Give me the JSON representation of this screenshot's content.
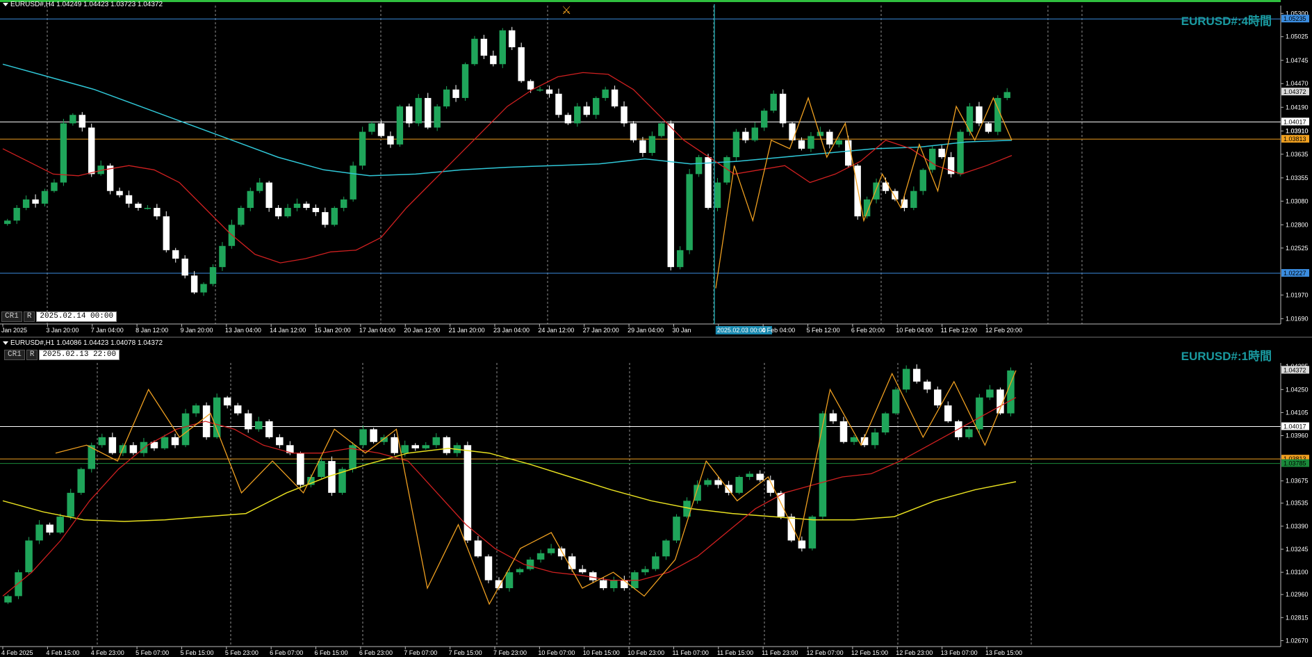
{
  "chart_data": [
    {
      "type": "candlestick",
      "symbol_line": "EURUSD#,H4  1.04249 1.04423 1.03723 1.04372",
      "title": "EURUSD#:4時間",
      "crosshair": {
        "tag1": "CR1",
        "tag2": "R",
        "datetime": "2025.02.14 00:00"
      },
      "ylim": [
        1.0166,
        1.0536
      ],
      "yticks": [
        1.053,
        1.05025,
        1.04745,
        1.0447,
        1.0419,
        1.0391,
        1.03635,
        1.03355,
        1.0308,
        1.028,
        1.02525,
        1.0197,
        1.0169
      ],
      "x_labels": [
        "Jan 2025",
        "3 Jan 20:00",
        "7 Jan 04:00",
        "8 Jan 12:00",
        "9 Jan 20:00",
        "13 Jan 04:00",
        "14 Jan 12:00",
        "15 Jan 20:00",
        "17 Jan 04:00",
        "20 Jan 12:00",
        "21 Jan 20:00",
        "23 Jan 04:00",
        "24 Jan 12:00",
        "27 Jan 20:00",
        "29 Jan 04:00",
        "30 Jan",
        "2025.02.03 00:00",
        "4 Feb 04:00",
        "5 Feb 12:00",
        "6 Feb 20:00",
        "10 Feb 04:00",
        "11 Feb 12:00",
        "12 Feb 20:00"
      ],
      "hlines": [
        {
          "value": 1.05235,
          "color": "#3b8de0",
          "label": "1.05235",
          "label_bg": "#3b8de0"
        },
        {
          "value": 1.04017,
          "color": "#ffffff",
          "label": "1.04017",
          "label_bg": "#ffffff"
        },
        {
          "value": 1.03813,
          "color": "#f0a020",
          "label": "1.03813",
          "label_bg": "#f0a020"
        },
        {
          "value": 1.02227,
          "color": "#3b8de0",
          "label": "1.02227",
          "label_bg": "#3b8de0"
        }
      ],
      "last_price": {
        "value": 1.04372,
        "label": "1.04372"
      },
      "extra_labels": [
        {
          "value": 1.0391,
          "text": "1.03910"
        }
      ],
      "highlight_label": "2025.02.03 00:00",
      "close_path": [
        1.0285,
        1.03,
        1.031,
        1.0305,
        1.032,
        1.033,
        1.04,
        1.041,
        1.0395,
        1.034,
        1.035,
        1.032,
        1.0315,
        1.0305,
        1.03,
        1.03,
        1.029,
        1.025,
        1.024,
        1.022,
        1.02,
        1.021,
        1.023,
        1.0255,
        1.028,
        1.03,
        1.032,
        1.033,
        1.03,
        1.029,
        1.03,
        1.0305,
        1.03,
        1.0295,
        1.028,
        1.03,
        1.031,
        1.035,
        1.039,
        1.04,
        1.0385,
        1.0375,
        1.042,
        1.04,
        1.043,
        1.0395,
        1.042,
        1.044,
        1.043,
        1.047,
        1.05,
        1.048,
        1.047,
        1.051,
        1.049,
        1.045,
        1.044,
        1.044,
        1.0435,
        1.041,
        1.04,
        1.042,
        1.041,
        1.043,
        1.044,
        1.042,
        1.04,
        1.038,
        1.0365,
        1.0385,
        1.04,
        1.023,
        1.025,
        1.034,
        1.036,
        1.03,
        1.033,
        1.036,
        1.039,
        1.038,
        1.0395,
        1.0415,
        1.0435,
        1.04,
        1.038,
        1.037,
        1.0385,
        1.039,
        1.0375,
        1.038,
        1.035,
        1.029,
        1.031,
        1.033,
        1.032,
        1.031,
        1.03,
        1.032,
        1.0345,
        1.037,
        1.036,
        1.034,
        1.039,
        1.042,
        1.04,
        1.039,
        1.043,
        1.0437
      ],
      "ma_red": [
        1.037,
        1.0355,
        1.034,
        1.0338,
        1.0345,
        1.035,
        1.0345,
        1.033,
        1.03,
        1.027,
        1.0245,
        1.0235,
        1.024,
        1.0248,
        1.025,
        1.0265,
        1.03,
        1.033,
        1.036,
        1.039,
        1.042,
        1.044,
        1.0455,
        1.046,
        1.0458,
        1.044,
        1.041,
        1.038,
        1.036,
        1.034,
        1.0345,
        1.035,
        1.033,
        1.034,
        1.0355,
        1.038,
        1.037,
        1.035,
        1.034,
        1.035,
        1.0362
      ],
      "ma_cyan": [
        1.047,
        1.0455,
        1.044,
        1.042,
        1.04,
        1.038,
        1.036,
        1.0345,
        1.0338,
        1.034,
        1.0345,
        1.0348,
        1.035,
        1.0352,
        1.0358,
        1.0352,
        1.0355,
        1.036,
        1.0365,
        1.037,
        1.0372,
        1.0378,
        1.038
      ],
      "zigzag": [
        1.0205,
        1.035,
        1.0285,
        1.038,
        1.037,
        1.043,
        1.036,
        1.04,
        1.0285,
        1.034,
        1.03,
        1.0375,
        1.032,
        1.042,
        1.038,
        1.043,
        1.038
      ]
    },
    {
      "type": "candlestick",
      "symbol_line": "EURUSD#,H1  1.04086 1.04423 1.04078 1.04372",
      "title": "EURUSD#:1時間",
      "crosshair": {
        "tag1": "CR1",
        "tag2": "R",
        "datetime": "2025.02.13 22:00"
      },
      "ylim": [
        1.0265,
        1.044
      ],
      "yticks": [
        1.04395,
        1.0425,
        1.04105,
        1.0396,
        1.03675,
        1.03535,
        1.0339,
        1.03245,
        1.031,
        1.0296,
        1.02815,
        1.0267
      ],
      "x_labels": [
        "4 Feb 2025",
        "4 Feb 15:00",
        "4 Feb 23:00",
        "5 Feb 07:00",
        "5 Feb 15:00",
        "5 Feb 23:00",
        "6 Feb 07:00",
        "6 Feb 15:00",
        "6 Feb 23:00",
        "7 Feb 07:00",
        "7 Feb 15:00",
        "7 Feb 23:00",
        "10 Feb 07:00",
        "10 Feb 15:00",
        "10 Feb 23:00",
        "11 Feb 07:00",
        "11 Feb 15:00",
        "11 Feb 23:00",
        "12 Feb 07:00",
        "12 Feb 15:00",
        "12 Feb 23:00",
        "13 Feb 07:00",
        "13 Feb 15:00"
      ],
      "hlines": [
        {
          "value": 1.04017,
          "color": "#ffffff",
          "label": "1.04017",
          "label_bg": "#ffffff"
        },
        {
          "value": 1.03813,
          "color": "#f0a020",
          "label": "1.03813",
          "label_bg": "#f0a020"
        },
        {
          "value": 1.03785,
          "color": "#1a8a3a",
          "label": "1.03785",
          "label_bg": "#1a8a3a"
        }
      ],
      "last_price": {
        "value": 1.04372,
        "label": "1.04372"
      },
      "close_path": [
        1.0295,
        1.031,
        1.033,
        1.034,
        1.0335,
        1.0345,
        1.036,
        1.0375,
        1.039,
        1.0395,
        1.0385,
        1.039,
        1.0385,
        1.0392,
        1.0388,
        1.0395,
        1.039,
        1.041,
        1.0415,
        1.0395,
        1.042,
        1.0415,
        1.041,
        1.04,
        1.0405,
        1.0395,
        1.039,
        1.0385,
        1.0365,
        1.037,
        1.038,
        1.036,
        1.0375,
        1.039,
        1.04,
        1.0392,
        1.0395,
        1.0385,
        1.039,
        1.0388,
        1.039,
        1.0395,
        1.0385,
        1.039,
        1.033,
        1.032,
        1.0305,
        1.03,
        1.031,
        1.0312,
        1.0318,
        1.0322,
        1.0325,
        1.032,
        1.0312,
        1.031,
        1.0305,
        1.03,
        1.0305,
        1.03,
        1.031,
        1.0312,
        1.032,
        1.033,
        1.0345,
        1.0355,
        1.0365,
        1.0368,
        1.0365,
        1.036,
        1.037,
        1.0372,
        1.0368,
        1.036,
        1.0345,
        1.033,
        1.0325,
        1.0345,
        1.041,
        1.0405,
        1.0392,
        1.0395,
        1.039,
        1.0398,
        1.041,
        1.0425,
        1.0438,
        1.043,
        1.0425,
        1.0415,
        1.0405,
        1.0395,
        1.04,
        1.042,
        1.0425,
        1.041,
        1.0437
      ],
      "ma_red": [
        1.0295,
        1.031,
        1.033,
        1.0355,
        1.0375,
        1.039,
        1.04,
        1.0405,
        1.04,
        1.039,
        1.0385,
        1.0385,
        1.0388,
        1.0385,
        1.038,
        1.036,
        1.034,
        1.0325,
        1.0315,
        1.031,
        1.0308,
        1.0305,
        1.0305,
        1.031,
        1.032,
        1.0335,
        1.035,
        1.036,
        1.0365,
        1.037,
        1.0372,
        1.038,
        1.039,
        1.04,
        1.041,
        1.042
      ],
      "ma_yellow": [
        1.0355,
        1.0348,
        1.0343,
        1.0342,
        1.0343,
        1.0345,
        1.0347,
        1.036,
        1.037,
        1.0378,
        1.0385,
        1.0388,
        1.0385,
        1.0378,
        1.037,
        1.0362,
        1.0355,
        1.035,
        1.0347,
        1.0345,
        1.0343,
        1.0343,
        1.0345,
        1.0355,
        1.0362,
        1.0367
      ],
      "zigzag": [
        1.0385,
        1.039,
        1.038,
        1.0425,
        1.0395,
        1.041,
        1.036,
        1.038,
        1.036,
        1.04,
        1.0385,
        1.04,
        1.03,
        1.034,
        1.029,
        1.0325,
        1.0335,
        1.03,
        1.031,
        1.0295,
        1.0318,
        1.038,
        1.0355,
        1.037,
        1.033,
        1.0425,
        1.039,
        1.0435,
        1.0395,
        1.043,
        1.039,
        1.0437
      ]
    }
  ],
  "colors": {
    "bull": "#1fa55a",
    "bear": "#ffffff",
    "grid": "#cccccc",
    "ma_red": "#d02020",
    "ma_cyan": "#30c8d8",
    "ma_yellow": "#e8e020",
    "zigzag": "#f0a020",
    "axis_text": "#ffffff"
  },
  "icons": {
    "marker": "cross-swords-icon"
  }
}
